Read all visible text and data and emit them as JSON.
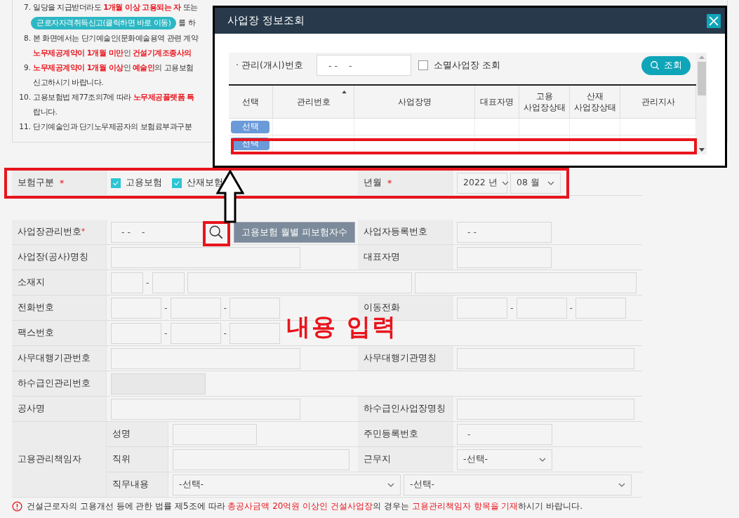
{
  "notes": [
    {
      "number": "7.",
      "lines": [
        "일당을 지급받더라도 **1개월 이상 고용되는 자** 또는"
      ],
      "link": "근로자자격취득신고(클릭하면 바로 이동)",
      "link_suffix": "를 하"
    },
    {
      "number": "8.",
      "lines": [
        "본 화면에서는 단기예술인(문화예술용역 관련 계약",
        "**노무제공계약이 1개월 미만**인 **건설기계조종사의**"
      ]
    },
    {
      "number": "9.",
      "lines": [
        "**노무제공계약이 1개월 이상**인 **예술인**의 고용보험",
        "신고하시기 바랍니다."
      ]
    },
    {
      "number": "10.",
      "lines": [
        "고용보험법 제77조의7에 따라 **노무제공플랫폼 특**",
        "랍니다."
      ]
    },
    {
      "number": "11.",
      "lines": [
        "단기예술인과 단기노무제공자의 보험료부과구분"
      ]
    }
  ],
  "insurance_row": {
    "label": "보험구분",
    "required_mark": "*",
    "options": [
      {
        "label": "고용보험",
        "checked": true
      },
      {
        "label": "산재보험",
        "checked": true
      }
    ],
    "period_label": "년월",
    "period_mark": "*",
    "year": "2022 년",
    "month": "08 월"
  },
  "rows": [
    {
      "kind": "business_no",
      "label": "사업장관리번호",
      "mark": "*",
      "value": "- -    -",
      "button": "고용보험 월별 피보험자수",
      "right_label": "사업자등록번호",
      "right_value": "- -"
    },
    {
      "kind": "pair",
      "label": "사업장(공사)명칭",
      "right_label": "대표자명",
      "right_narrow": true
    },
    {
      "kind": "address",
      "label": "소재지",
      "separator": "-"
    },
    {
      "kind": "phones",
      "label": "전화번호",
      "separators": [
        "-",
        "-"
      ],
      "right_label": "이동전화",
      "right_separators": [
        "-",
        "-"
      ]
    },
    {
      "kind": "phones",
      "label": "팩스번호",
      "separators": [
        "-",
        "-"
      ]
    },
    {
      "kind": "pair",
      "label": "사무대행기관번호",
      "right_label": "사무대행기관명칭",
      "right_narrow": false
    },
    {
      "kind": "disabled",
      "label": "하수급인관리번호"
    },
    {
      "kind": "pair",
      "label": "공사명",
      "right_label": "하수급인사업장명칭",
      "right_narrow": false
    }
  ],
  "manager": {
    "label": "고용관리책임자",
    "rows": [
      {
        "kind": "name",
        "label": "성명",
        "right_label": "주민등록번호",
        "right_value": "-"
      },
      {
        "kind": "position",
        "label": "직위",
        "right_label": "근무지",
        "right_select": "-선택-"
      },
      {
        "kind": "duty",
        "label": "직무내용",
        "select": "-선택-",
        "select2": "-선택-"
      }
    ]
  },
  "footer_note": "건설근로자의 고용개선 등에 관한 법률 제5조에 따라 **총공사금액 20억원 이상인 건설사업장**의 경우는 **고용관리책임자 항목을 기재**하시기 바랍니다.",
  "modal": {
    "title": "사업장 정보조회",
    "search_bullet": "·",
    "search_label": "관리(개시)번호",
    "search_value": "- -    -",
    "closed_label": "소멸사업장 조회",
    "closed_checked": false,
    "search_button": "조회",
    "columns": [
      {
        "label": "선택",
        "sorted": false
      },
      {
        "label": "관리번호",
        "sorted": true
      },
      {
        "label": "사업장명",
        "sorted": false
      },
      {
        "label": "대표자명",
        "sorted": false
      },
      {
        "label": "고용\n사업장상태",
        "sorted": false
      },
      {
        "label": "산재\n사업장상태",
        "sorted": false
      },
      {
        "label": "관리지사",
        "sorted": false
      }
    ],
    "rows": [
      {
        "select": "선택"
      },
      {
        "select": "선택"
      }
    ]
  },
  "annotation": {
    "label": "내용 입력"
  }
}
